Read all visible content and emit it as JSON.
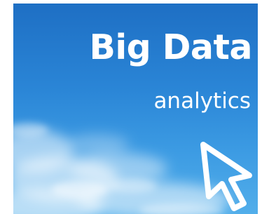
{
  "title": "Big Data",
  "subtitle": "analytics",
  "icons": {
    "cursor": "arrow-cursor-icon"
  },
  "colors": {
    "sky_top": "#1e6fc4",
    "sky_bottom": "#52aeea",
    "text": "#ffffff"
  }
}
